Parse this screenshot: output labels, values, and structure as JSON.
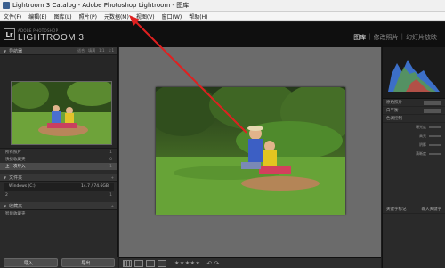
{
  "window": {
    "title": "Lightroom 3 Catalog - Adobe Photoshop Lightroom - 图库"
  },
  "menubar": {
    "items": [
      "文件(F)",
      "编辑(E)",
      "图库(L)",
      "照片(P)",
      "元数据(M)",
      "视图(V)",
      "窗口(W)",
      "帮助(H)"
    ]
  },
  "header": {
    "logo": "Lr",
    "brand_small": "ADOBE PHOTOSHOP",
    "brand_large": "LIGHTROOM 3",
    "modules": [
      "图库",
      "修改照片",
      "幻灯片放映"
    ]
  },
  "left_panel": {
    "navigator_title": "导航器",
    "navigator_options": [
      "适合",
      "填满",
      "1:1",
      "1:1"
    ],
    "catalog_rows": [
      {
        "label": "所有照片",
        "count": "1"
      },
      {
        "label": "快捷收藏夹",
        "count": "0"
      },
      {
        "label": "上一次导入",
        "count": "1"
      }
    ],
    "folders_title": "文件夹",
    "folder_rows": [
      {
        "label": "Windows (C:)",
        "count": "14.7 / 74.6GB"
      },
      {
        "label": "2",
        "count": "1"
      }
    ],
    "collections_title": "收藏夹",
    "collection_row": "智能收藏夹",
    "import_button": "导入...",
    "export_button": "导出..."
  },
  "right_panel": {
    "rows": [
      "原始照片",
      "白平衡",
      "色调控制"
    ],
    "sliders": [
      "曝光度",
      "高光",
      "阴影",
      "清晰度"
    ],
    "bottom_left": "关键字标记",
    "bottom_right": "输入关键字"
  },
  "toolbar": {
    "stars": "★★★★★",
    "rotate": "↶ ↷"
  },
  "colors": {
    "arrow": "#e02020",
    "panel_bg": "#2a2a2a",
    "center_bg": "#6b6b6b"
  }
}
